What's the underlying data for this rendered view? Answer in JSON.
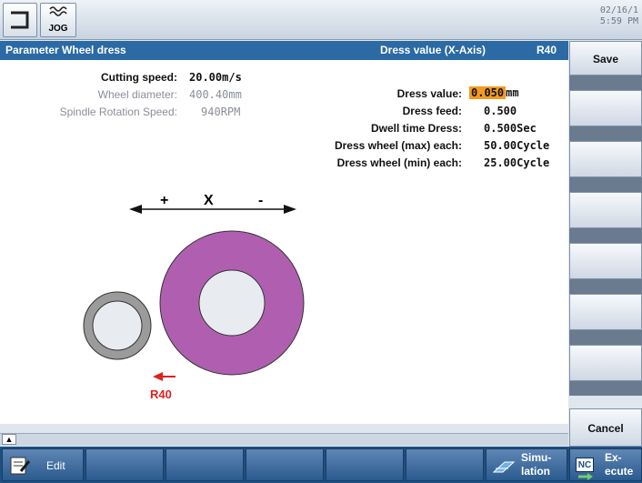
{
  "topbar": {
    "mode_label": "JOG",
    "date": "02/16/1",
    "time": "5:59 PM"
  },
  "title": {
    "left": "Parameter Wheel dress",
    "right": "Dress value (X-Axis)",
    "code": "R40"
  },
  "params_left": [
    {
      "label": "Cutting speed:",
      "value": "20.00",
      "unit": "m/s"
    },
    {
      "label": "Wheel diameter:",
      "value": "400.40",
      "unit": "mm"
    },
    {
      "label": "Spindle Rotation Speed:",
      "value": "940",
      "unit": "RPM"
    }
  ],
  "params_right": [
    {
      "label": "Dress value:",
      "value": "0.050",
      "unit": "mm"
    },
    {
      "label": "Dress feed:",
      "value": "0.500",
      "unit": ""
    },
    {
      "label": "Dwell time Dress:",
      "value": "0.500",
      "unit": "Sec"
    },
    {
      "label": "Dress wheel (max) each:",
      "value": "50.00",
      "unit": "Cycle"
    },
    {
      "label": "Dress wheel (min) each:",
      "value": "25.00",
      "unit": "Cycle"
    }
  ],
  "diagram": {
    "plus": "+",
    "axis": "X",
    "minus": "-",
    "arrow_label": "R40",
    "colors": {
      "wheel": "#b05fb0",
      "dresser": "#9b9b9b",
      "arrow": "#e02020"
    }
  },
  "softkeys": {
    "save": "Save",
    "cancel": "Cancel"
  },
  "bottom": {
    "edit": "Edit",
    "simulation": "Simu-\nlation",
    "execute_prefix": "NC",
    "execute": "Ex-\necute"
  }
}
